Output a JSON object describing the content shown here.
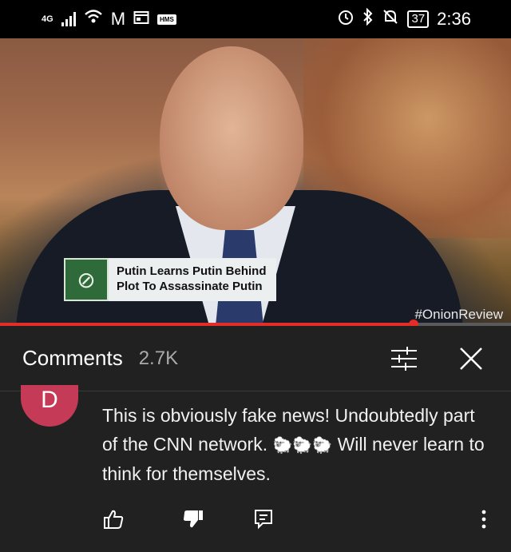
{
  "status_bar": {
    "network": "4G",
    "mail_icon": "M",
    "hms_badge": "HMS",
    "battery": "37",
    "time": "2:36"
  },
  "video": {
    "lower_third": "Putin Learns Putin Behind Plot To Assassinate Putin",
    "hashtag": "#OnionReview",
    "progress_fraction": 0.81
  },
  "comments_panel": {
    "title": "Comments",
    "count": "2.7K"
  },
  "comment": {
    "avatar_letter": "D",
    "text_part1": "This is obviously fake news! Undoubtedly part of the CNN network.",
    "sheep_emoji": "🐑🐑🐑",
    "text_part2": "Will never learn to think for themselves."
  },
  "icons": {
    "like": "thumbs-up-icon",
    "dislike": "thumbs-down-icon",
    "reply": "reply-icon",
    "more": "more-vertical-icon",
    "sort": "sort-filter-icon",
    "close": "close-icon"
  },
  "colors": {
    "progress": "#e52d27",
    "avatar": "#c43a57",
    "panel_bg": "#212121"
  }
}
